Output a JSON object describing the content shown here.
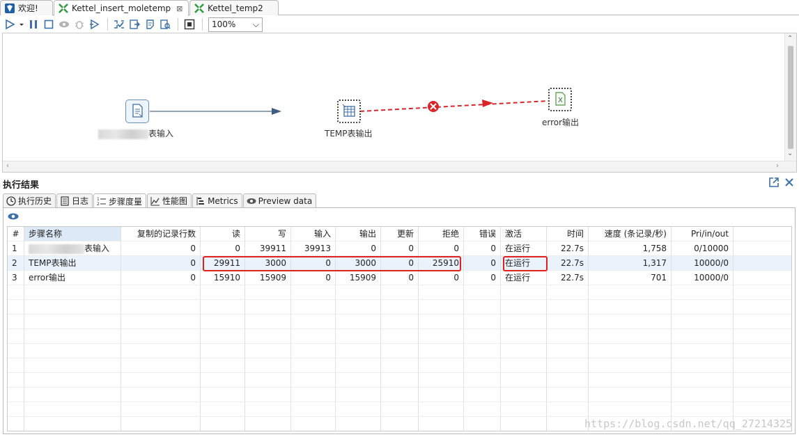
{
  "tabs": [
    {
      "label": "欢迎!",
      "icon": "welcome-icon"
    },
    {
      "label": "Kettel_insert_moletemp",
      "icon": "transformation-icon",
      "active": true,
      "closable": true
    },
    {
      "label": "Kettel_temp2",
      "icon": "transformation-icon"
    }
  ],
  "toolbar": {
    "zoom": "100%"
  },
  "canvas": {
    "steps": [
      {
        "id": "input",
        "label": "表输入",
        "icon": "table-input-icon"
      },
      {
        "id": "temp",
        "label": "TEMP表输出",
        "icon": "table-output-icon"
      },
      {
        "id": "error",
        "label": "error输出",
        "icon": "excel-output-icon"
      }
    ]
  },
  "results": {
    "title": "执行结果",
    "tabs": [
      {
        "label": "执行历史",
        "icon": "history-icon"
      },
      {
        "label": "日志",
        "icon": "log-icon"
      },
      {
        "label": "步骤度量",
        "icon": "step-metrics-icon",
        "active": true
      },
      {
        "label": "性能图",
        "icon": "performance-icon"
      },
      {
        "label": "Metrics",
        "icon": "metrics-icon"
      },
      {
        "label": "Preview data",
        "icon": "preview-icon"
      }
    ],
    "columns": [
      "#",
      "步骤名称",
      "复制的记录行数",
      "读",
      "写",
      "输入",
      "输出",
      "更新",
      "拒绝",
      "错误",
      "激活",
      "时间",
      "速度 (条记录/秒)",
      "Pri/in/out"
    ],
    "rows": [
      [
        "1",
        "表输入",
        "0",
        "0",
        "39911",
        "39913",
        "0",
        "0",
        "0",
        "0",
        "在运行",
        "22.7s",
        "1,758",
        "0/10000"
      ],
      [
        "2",
        "TEMP表输出",
        "0",
        "29911",
        "3000",
        "0",
        "3000",
        "0",
        "25910",
        "0",
        "在运行",
        "22.7s",
        "1,317",
        "10000/0"
      ],
      [
        "3",
        "error输出",
        "0",
        "15910",
        "15909",
        "0",
        "15909",
        "0",
        "0",
        "0",
        "在运行",
        "22.7s",
        "701",
        "10000/0"
      ]
    ]
  },
  "watermark": "https://blog.csdn.net/qq_27214325",
  "colors": {
    "accent": "#3d6fa8",
    "highlight": "#e0201c",
    "error_hop": "#d9252a"
  }
}
